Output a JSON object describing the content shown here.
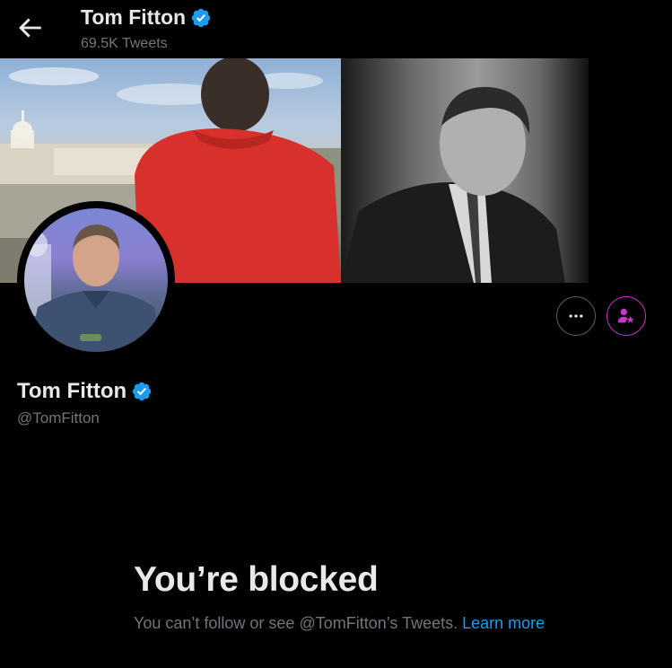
{
  "header": {
    "name": "Tom Fitton",
    "tweet_count": "69.5K Tweets"
  },
  "profile": {
    "name": "Tom Fitton",
    "handle": "@TomFitton",
    "verified": true
  },
  "blocked": {
    "title": "You’re blocked",
    "message": "You can’t follow or see @TomFitton’s Tweets.",
    "link": "Learn more"
  },
  "icons": {
    "back": "arrow-left-icon",
    "verified": "verified-badge-icon",
    "more": "more-horizontal-icon",
    "subscribe": "subscribe-star-person-icon"
  },
  "colors": {
    "background": "#000000",
    "text": "#e7e9ea",
    "muted": "#71767b",
    "link": "#1d9bf0",
    "verified": "#1d9bf0",
    "subscribe": "#c936cc"
  }
}
